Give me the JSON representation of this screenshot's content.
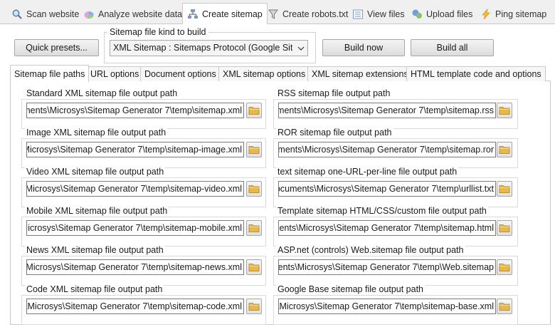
{
  "top_tabs": [
    {
      "label": "Scan website",
      "icon": "magnifier-icon"
    },
    {
      "label": "Analyze website data",
      "icon": "pie-chart-icon"
    },
    {
      "label": "Create sitemap",
      "icon": "sitemap-icon"
    },
    {
      "label": "Create robots.txt",
      "icon": "filter-icon"
    },
    {
      "label": "View files",
      "icon": "list-icon"
    },
    {
      "label": "Upload files",
      "icon": "upload-icon"
    },
    {
      "label": "Ping sitemap",
      "icon": "lightning-icon"
    }
  ],
  "toolbar": {
    "quick_presets_label": "Quick presets...",
    "sitemap_kind_label": "Sitemap file kind to build",
    "sitemap_kind_value": "XML Sitemap : Sitemaps Protocol (Google Sitemaps)",
    "build_now_label": "Build now",
    "build_all_label": "Build all"
  },
  "sub_tabs": [
    "Sitemap file paths",
    "URL options",
    "Document options",
    "XML sitemap options",
    "XML sitemap extensions",
    "HTML template code and options"
  ],
  "paths": {
    "left": [
      {
        "label": "Standard XML sitemap file output path",
        "value": "ments\\Microsys\\Sitemap Generator 7\\temp\\sitemap.xml"
      },
      {
        "label": "Image XML sitemap file output path",
        "value": "\\Microsys\\Sitemap Generator 7\\temp\\sitemap-image.xml"
      },
      {
        "label": "Video XML sitemap file output path",
        "value": "\\Microsys\\Sitemap Generator 7\\temp\\sitemap-video.xml"
      },
      {
        "label": "Mobile XML sitemap file output path",
        "value": "\\Microsys\\Sitemap Generator 7\\temp\\sitemap-mobile.xml"
      },
      {
        "label": "News XML sitemap file output path",
        "value": ",Microsys\\Sitemap Generator 7\\temp\\sitemap-news.xml"
      },
      {
        "label": "Code XML sitemap file output path",
        "value": "\\Microsys\\Sitemap Generator 7\\temp\\sitemap-code.xml"
      }
    ],
    "right": [
      {
        "label": "RSS sitemap file output path",
        "value": "ments\\Microsys\\Sitemap Generator 7\\temp\\sitemap.rss"
      },
      {
        "label": "ROR sitemap file output path",
        "value": "ments\\Microsys\\Sitemap Generator 7\\temp\\sitemap.ror"
      },
      {
        "label": "text sitemap one-URL-per-line file output path",
        "value": "ocuments\\Microsys\\Sitemap Generator 7\\temp\\urllist.txt"
      },
      {
        "label": "Template sitemap HTML/CSS/custom file output path",
        "value": "ents\\Microsys\\Sitemap Generator 7\\temp\\sitemap.html"
      },
      {
        "label": "ASP.net (controls) Web.sitemap file output path",
        "value": "ments\\Microsys\\Sitemap Generator 7\\temp\\Web.sitemap"
      },
      {
        "label": "Google Base sitemap file output path",
        "value": "\\Microsys\\Sitemap Generator 7\\temp\\sitemap-base.xml"
      }
    ]
  },
  "colors": {
    "folder": "#e8b94a",
    "active_tab": "#ffffff",
    "border": "#c9c9c9"
  }
}
